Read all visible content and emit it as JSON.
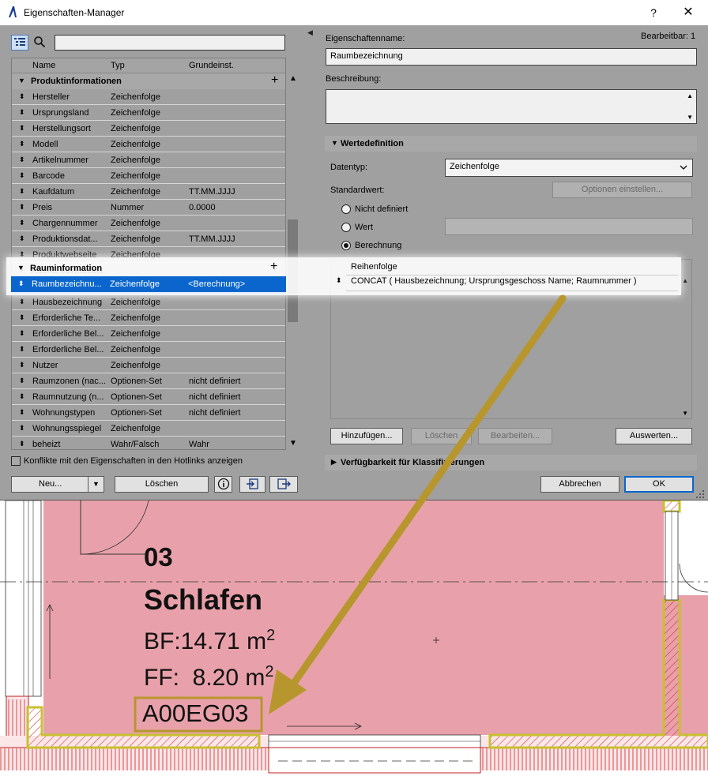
{
  "window": {
    "title": "Eigenschaften-Manager",
    "help": "?",
    "close": "✕"
  },
  "table": {
    "headers": [
      "Name",
      "Typ",
      "Grundeinst."
    ],
    "groups": [
      {
        "name": "Produktinformationen",
        "rows": [
          {
            "name": "Hersteller",
            "type": "Zeichenfolge",
            "default": ""
          },
          {
            "name": "Ursprungsland",
            "type": "Zeichenfolge",
            "default": ""
          },
          {
            "name": "Herstellungsort",
            "type": "Zeichenfolge",
            "default": ""
          },
          {
            "name": "Modell",
            "type": "Zeichenfolge",
            "default": ""
          },
          {
            "name": "Artikelnummer",
            "type": "Zeichenfolge",
            "default": ""
          },
          {
            "name": "Barcode",
            "type": "Zeichenfolge",
            "default": ""
          },
          {
            "name": "Kaufdatum",
            "type": "Zeichenfolge",
            "default": "TT.MM.JJJJ"
          },
          {
            "name": "Preis",
            "type": "Nummer",
            "default": "0.0000"
          },
          {
            "name": "Chargennummer",
            "type": "Zeichenfolge",
            "default": ""
          },
          {
            "name": "Produktionsdat...",
            "type": "Zeichenfolge",
            "default": "TT.MM.JJJJ"
          },
          {
            "name": "Produktwebseite",
            "type": "Zeichenfolge",
            "default": ""
          }
        ]
      },
      {
        "name": "Rauminformation",
        "rows": [
          {
            "name": "Raumbezeichnu...",
            "type": "Zeichenfolge",
            "default": "<Berechnung>",
            "selected": true
          },
          {
            "name": "Hausbezeichnung",
            "type": "Zeichenfolge",
            "default": ""
          },
          {
            "name": "Erforderliche Te...",
            "type": "Zeichenfolge",
            "default": ""
          },
          {
            "name": "Erforderliche Bel...",
            "type": "Zeichenfolge",
            "default": ""
          },
          {
            "name": "Erforderliche Bel...",
            "type": "Zeichenfolge",
            "default": ""
          },
          {
            "name": "Nutzer",
            "type": "Zeichenfolge",
            "default": ""
          },
          {
            "name": "Raumzonen (nac...",
            "type": "Optionen-Set",
            "default": "nicht definiert"
          },
          {
            "name": "Raumnutzung (n...",
            "type": "Optionen-Set",
            "default": "nicht definiert"
          },
          {
            "name": "Wohnungstypen",
            "type": "Optionen-Set",
            "default": "nicht definiert"
          },
          {
            "name": "Wohnungsspiegel",
            "type": "Zeichenfolge",
            "default": ""
          },
          {
            "name": "beheizt",
            "type": "Wahr/Falsch",
            "default": "Wahr"
          }
        ]
      }
    ]
  },
  "left_footer": {
    "conflict_label": "Konflikte mit den Eigenschaften in den Hotlinks anzeigen",
    "new_label": "Neu...",
    "delete_label": "Löschen"
  },
  "right": {
    "name_label": "Eigenschaftenname:",
    "editable": "Bearbeitbar: 1",
    "name_value": "Raumbezeichnung",
    "desc_label": "Beschreibung:",
    "value_def_title": "Wertedefinition",
    "datatype_label": "Datentyp:",
    "datatype_value": "Zeichenfolge",
    "default_label": "Standardwert:",
    "options_button": "Optionen einstellen...",
    "radio_undefined": "Nicht definiert",
    "radio_value": "Wert",
    "radio_calc": "Berechnung",
    "order_header": "Reihenfolge",
    "formula": "CONCAT ( Hausbezeichnung; Ursprungsgeschoss Name; Raumnummer )",
    "add_button": "Hinzufügen...",
    "delete_button": "Löschen",
    "edit_button": "Bearbeiten...",
    "evaluate_button": "Auswerten...",
    "availability_title": "Verfügbarkeit für Klassifizierungen",
    "cancel_button": "Abbrechen",
    "ok_button": "OK"
  },
  "plan": {
    "room_number": "03",
    "room_name": "Schlafen",
    "bf": "BF:14.71 m",
    "ff": "FF:  8.20 m",
    "sup": "2",
    "room_code": "A00EG03"
  },
  "colors": {
    "selection": "#0a66cc",
    "room_fill": "#e8a1aa",
    "arrow": "#b8962e"
  }
}
